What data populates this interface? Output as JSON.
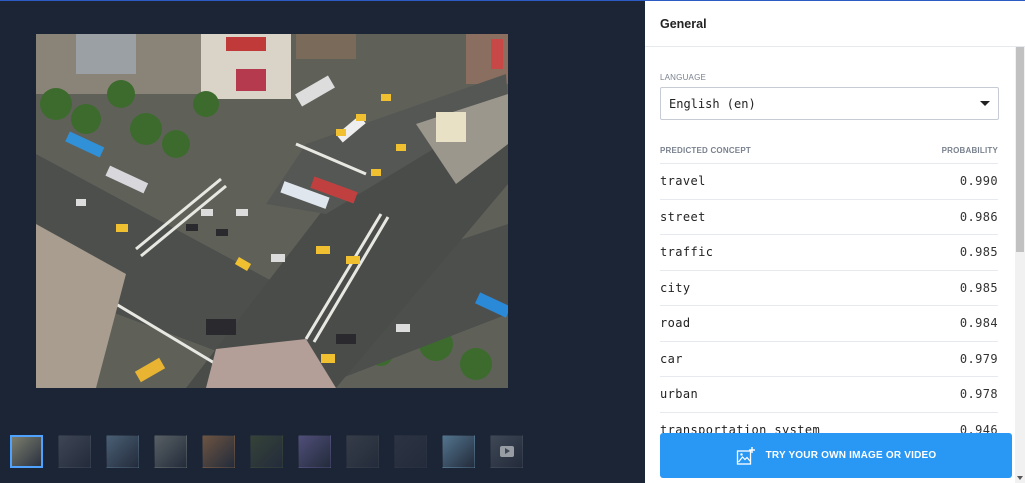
{
  "panel": {
    "title": "General",
    "language_label": "LANGUAGE",
    "language_value": "English (en)",
    "concept_header": "PREDICTED CONCEPT",
    "probability_header": "PROBABILITY",
    "predictions": [
      {
        "concept": "travel",
        "probability": "0.990"
      },
      {
        "concept": "street",
        "probability": "0.986"
      },
      {
        "concept": "traffic",
        "probability": "0.985"
      },
      {
        "concept": "city",
        "probability": "0.985"
      },
      {
        "concept": "road",
        "probability": "0.984"
      },
      {
        "concept": "car",
        "probability": "0.979"
      },
      {
        "concept": "urban",
        "probability": "0.978"
      },
      {
        "concept": "transportation system",
        "probability": "0.946"
      }
    ],
    "try_button_label": "TRY YOUR OWN IMAGE OR VIDEO"
  },
  "thumbnails": [
    {
      "name": "thumb-city-intersection",
      "active": true,
      "color": "#7b7d6c"
    },
    {
      "name": "thumb-road",
      "active": false,
      "color": "#5a6170"
    },
    {
      "name": "thumb-person-blue",
      "active": false,
      "color": "#6f8ea8"
    },
    {
      "name": "thumb-building",
      "active": false,
      "color": "#8a8f8a"
    },
    {
      "name": "thumb-sunset-landscape",
      "active": false,
      "color": "#b07a4c"
    },
    {
      "name": "thumb-dog",
      "active": false,
      "color": "#4a5a3a"
    },
    {
      "name": "thumb-sky",
      "active": false,
      "color": "#7a6fb0"
    },
    {
      "name": "thumb-street-dark",
      "active": false,
      "color": "#4c5058"
    },
    {
      "name": "thumb-light-beams",
      "active": false,
      "color": "#3a4050"
    },
    {
      "name": "thumb-beach",
      "active": false,
      "color": "#7fb4d6"
    },
    {
      "name": "thumb-video",
      "active": false,
      "color": "#5c6470"
    }
  ]
}
